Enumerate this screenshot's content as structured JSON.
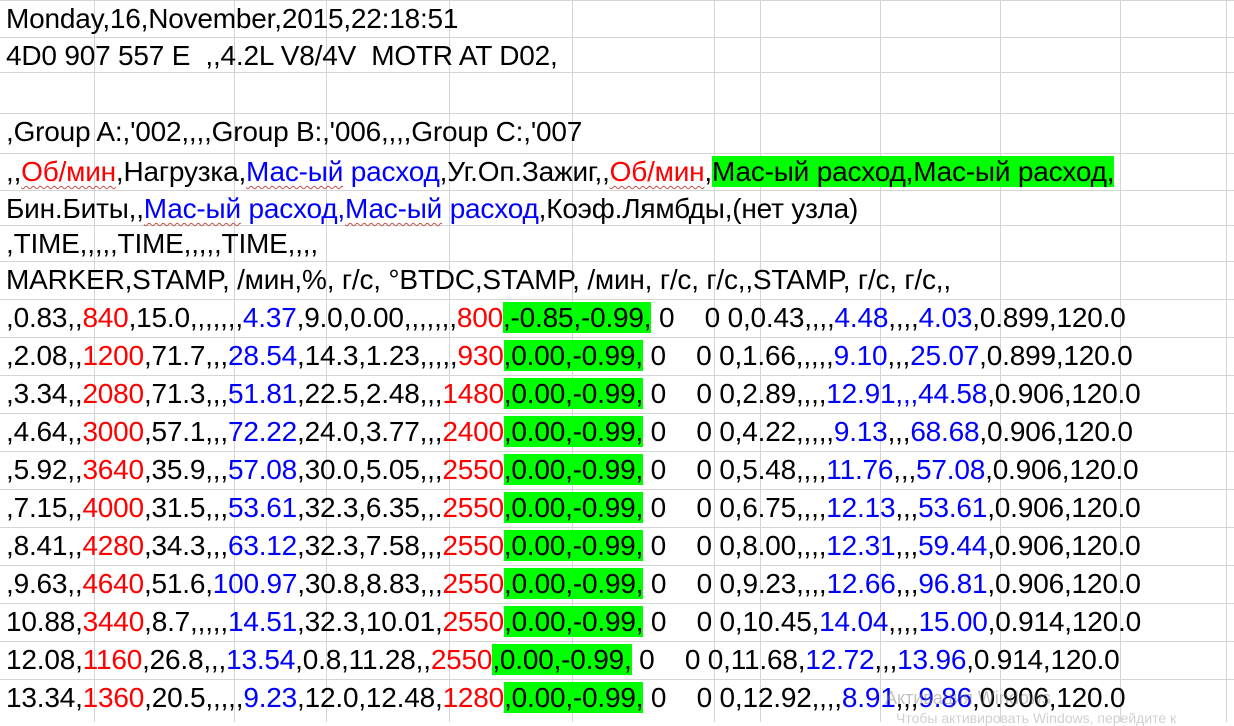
{
  "rows": [
    {
      "segs": [
        {
          "t": "Monday,16,November,2015,22:18:51"
        }
      ]
    },
    {
      "segs": [
        {
          "t": "4D0 907 557 E  ,,4.2L V8/4V  MOTR AT D02,"
        }
      ]
    },
    {
      "segs": [
        {
          "t": ""
        }
      ]
    },
    {
      "segs": [
        {
          "t": ",Group A:,'002,,,,Group B:,'006,,,,Group C:,'007"
        }
      ]
    },
    {
      "segs": [
        {
          "t": ",,"
        },
        {
          "t": "Об/мин",
          "c": "r",
          "w": true
        },
        {
          "t": ",Нагрузка,"
        },
        {
          "t": "Мас-ый",
          "c": "b",
          "w": true
        },
        {
          "t": " расход",
          "c": "b"
        },
        {
          "t": ",Уг.Оп.Зажиг,,"
        },
        {
          "t": "Об/мин",
          "c": "r",
          "w": true
        },
        {
          "t": ","
        },
        {
          "t": "Мас-ый расход,Мас-ый расход,",
          "bg": "g"
        }
      ]
    },
    {
      "segs": [
        {
          "t": "Бин.Биты,,"
        },
        {
          "t": "Мас-ый",
          "c": "b",
          "w": true
        },
        {
          "t": " расход,",
          "c": "b"
        },
        {
          "t": "Мас-ый",
          "c": "b",
          "w": true
        },
        {
          "t": " расход",
          "c": "b"
        },
        {
          "t": ",Коэф.Лямбды,(нет узла)"
        }
      ]
    },
    {
      "segs": [
        {
          "t": ",TIME,,,,,TIME,,,,,TIME,,,,"
        }
      ]
    },
    {
      "segs": [
        {
          "t": "MARKER,STAMP, /мин,%, г/с, °BTDC,STAMP, /мин, г/с, г/с,,STAMP, г/с, г/с,,"
        }
      ]
    },
    {
      "segs": [
        {
          "t": ",0.83,,"
        },
        {
          "t": "840",
          "c": "r"
        },
        {
          "t": ",15.0,,,,,,,"
        },
        {
          "t": "4.37",
          "c": "b"
        },
        {
          "t": ",9.0,0.00,,,,,,,"
        },
        {
          "t": "800",
          "c": "r"
        },
        {
          "t": ",-0.85,-0.99,",
          "bg": "g"
        },
        {
          "t": " 0    0 0,0.43,,,,"
        },
        {
          "t": "4.48",
          "c": "b"
        },
        {
          "t": ",,,,"
        },
        {
          "t": "4.03",
          "c": "b"
        },
        {
          "t": ",0.899,120.0"
        }
      ]
    },
    {
      "segs": [
        {
          "t": ",2.08,,"
        },
        {
          "t": "1200",
          "c": "r"
        },
        {
          "t": ",71.7,,,"
        },
        {
          "t": "28.54",
          "c": "b"
        },
        {
          "t": ",14.3,1.23,,,,,"
        },
        {
          "t": "930",
          "c": "r"
        },
        {
          "t": ",0.00,-0.99,",
          "bg": "g"
        },
        {
          "t": " 0    0 0,1.66,,,,,"
        },
        {
          "t": "9.10",
          "c": "b"
        },
        {
          "t": ",,,"
        },
        {
          "t": "25.07",
          "c": "b"
        },
        {
          "t": ",0.899,120.0"
        }
      ]
    },
    {
      "segs": [
        {
          "t": ",3.34,,"
        },
        {
          "t": "2080",
          "c": "r"
        },
        {
          "t": ",71.3,,,"
        },
        {
          "t": "51.81",
          "c": "b"
        },
        {
          "t": ",22.5,2.48,,,"
        },
        {
          "t": "1480",
          "c": "r"
        },
        {
          "t": ",0.00,-0.99,",
          "bg": "g"
        },
        {
          "t": " 0    0 0,2.89,,,,"
        },
        {
          "t": "12.91",
          "c": "b"
        },
        {
          "t": ",,,",
          "c": "b"
        },
        {
          "t": "44.58",
          "c": "b"
        },
        {
          "t": ",0.906,120.0"
        }
      ]
    },
    {
      "segs": [
        {
          "t": ",4.64,,"
        },
        {
          "t": "3000",
          "c": "r"
        },
        {
          "t": ",57.1,,,"
        },
        {
          "t": "72.22",
          "c": "b"
        },
        {
          "t": ",24.0,3.77,,,"
        },
        {
          "t": "2400",
          "c": "r"
        },
        {
          "t": ",0.00,-0.99,",
          "bg": "g"
        },
        {
          "t": " 0    0 0,4.22,,,,,"
        },
        {
          "t": "9.13",
          "c": "b"
        },
        {
          "t": ",,,"
        },
        {
          "t": "68.68",
          "c": "b"
        },
        {
          "t": ",0.906,120.0"
        }
      ]
    },
    {
      "segs": [
        {
          "t": ",5.92,,"
        },
        {
          "t": "3640",
          "c": "r"
        },
        {
          "t": ",35.9,,,"
        },
        {
          "t": "57.08",
          "c": "b"
        },
        {
          "t": ",30.0,5.05,,,"
        },
        {
          "t": "2550",
          "c": "r"
        },
        {
          "t": ",0.00,-0.99,",
          "bg": "g"
        },
        {
          "t": " 0    0 0,5.48,,,,"
        },
        {
          "t": "11.76",
          "c": "b"
        },
        {
          "t": ",,,"
        },
        {
          "t": "57.08",
          "c": "b"
        },
        {
          "t": ",0.906,120.0"
        }
      ]
    },
    {
      "segs": [
        {
          "t": ",7.15,,"
        },
        {
          "t": "4000",
          "c": "r"
        },
        {
          "t": ",31.5,,,"
        },
        {
          "t": "53.61",
          "c": "b"
        },
        {
          "t": ",32.3,6.35,,."
        },
        {
          "t": "2550",
          "c": "r"
        },
        {
          "t": ",0.00,-0.99,",
          "bg": "g"
        },
        {
          "t": " 0    0 0,6.75,,,,"
        },
        {
          "t": "12.13",
          "c": "b"
        },
        {
          "t": ",,,"
        },
        {
          "t": "53.61",
          "c": "b"
        },
        {
          "t": ",0.906,120.0"
        }
      ]
    },
    {
      "segs": [
        {
          "t": ",8.41,,"
        },
        {
          "t": "4280",
          "c": "r"
        },
        {
          "t": ",34.3,,,"
        },
        {
          "t": "63.12",
          "c": "b"
        },
        {
          "t": ",32.3,7.58,,,"
        },
        {
          "t": "2550",
          "c": "r"
        },
        {
          "t": ",0.00,-0.99,",
          "bg": "g"
        },
        {
          "t": " 0    0 0,8.00,,,,"
        },
        {
          "t": "12.31",
          "c": "b"
        },
        {
          "t": ",,,"
        },
        {
          "t": "59.44",
          "c": "b"
        },
        {
          "t": ",0.906,120.0"
        }
      ]
    },
    {
      "segs": [
        {
          "t": ",9.63,,"
        },
        {
          "t": "4640",
          "c": "r"
        },
        {
          "t": ",51.6,"
        },
        {
          "t": "100.97",
          "c": "b"
        },
        {
          "t": ",30.8,8.83,,,"
        },
        {
          "t": "2550",
          "c": "r"
        },
        {
          "t": ",0.00,-0.99,",
          "bg": "g"
        },
        {
          "t": " 0    0 0,9.23,,,,"
        },
        {
          "t": "12.66",
          "c": "b"
        },
        {
          "t": ",,,"
        },
        {
          "t": "96.81",
          "c": "b"
        },
        {
          "t": ",0.906,120.0"
        }
      ]
    },
    {
      "segs": [
        {
          "t": "10.88,"
        },
        {
          "t": "3440",
          "c": "r"
        },
        {
          "t": ",8.7,,,,,"
        },
        {
          "t": "14.51",
          "c": "b"
        },
        {
          "t": ",32.3,10.01,"
        },
        {
          "t": "2550",
          "c": "r"
        },
        {
          "t": ",0.00,-0.99,",
          "bg": "g"
        },
        {
          "t": " 0    0 0,10.45,"
        },
        {
          "t": "14.04",
          "c": "b"
        },
        {
          "t": ",,,,"
        },
        {
          "t": "15.00",
          "c": "b"
        },
        {
          "t": ",0.914,120.0"
        }
      ]
    },
    {
      "segs": [
        {
          "t": "12.08,"
        },
        {
          "t": "1160",
          "c": "r"
        },
        {
          "t": ",26.8,,,"
        },
        {
          "t": "13.54",
          "c": "b"
        },
        {
          "t": ",0.8,11.28,,"
        },
        {
          "t": "2550",
          "c": "r"
        },
        {
          "t": ",0.00,-0.99,",
          "bg": "g"
        },
        {
          "t": " 0    0 0,11.68,"
        },
        {
          "t": "12.72",
          "c": "b"
        },
        {
          "t": ",,,"
        },
        {
          "t": "13.96",
          "c": "b"
        },
        {
          "t": ",0.914,120.0"
        }
      ]
    },
    {
      "segs": [
        {
          "t": "13.34,"
        },
        {
          "t": "1360",
          "c": "r"
        },
        {
          "t": ",20.5,,,,,"
        },
        {
          "t": "9.23",
          "c": "b"
        },
        {
          "t": ",12.0,12.48,"
        },
        {
          "t": "1280",
          "c": "r"
        },
        {
          "t": ",0.00,-0.99,",
          "bg": "g"
        },
        {
          "t": " 0    0 0,12.92,,,,"
        },
        {
          "t": "8.91",
          "c": "b"
        },
        {
          "t": ",,,"
        },
        {
          "t": "9.86",
          "c": "b"
        },
        {
          "t": ",0.906,120.0"
        }
      ]
    }
  ],
  "watermark": {
    "line1": "Активация Windows",
    "line2": "Чтобы активировать Windows, перейдите к"
  },
  "colors": {
    "red": "#ff0000",
    "blue": "#0000ff",
    "green_highlight": "#00ff00",
    "grid": "#d4d4d4"
  }
}
